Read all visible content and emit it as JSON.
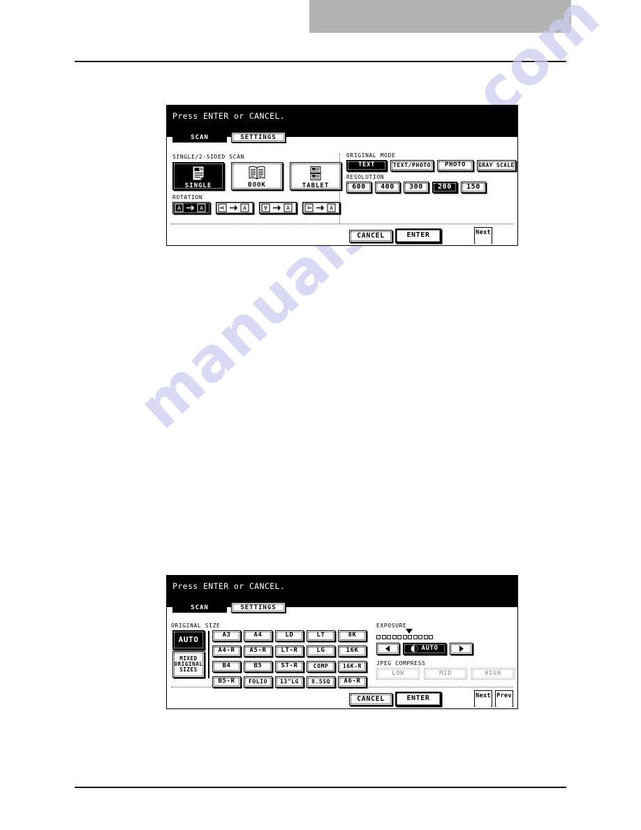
{
  "page": {
    "watermark_text": "manualshive.com",
    "header_block_color": "#b3b3b3"
  },
  "panel1": {
    "prompt": "Press ENTER or CANCEL.",
    "tabs": [
      {
        "label": "SCAN",
        "selected": true
      },
      {
        "label": "SETTINGS",
        "selected": false
      }
    ],
    "scan_mode": {
      "group_label": "SINGLE/2-SIDED SCAN",
      "options": [
        {
          "label": "SINGLE",
          "icon": "single-page-icon",
          "selected": true
        },
        {
          "label": "BOOK",
          "icon": "open-book-icon",
          "selected": false
        },
        {
          "label": "TABLET",
          "icon": "tablet-pages-icon",
          "selected": false
        }
      ]
    },
    "rotation": {
      "group_label": "ROTATION",
      "options": [
        {
          "name": "rotation-0",
          "from": "A",
          "to": "A",
          "selected": true
        },
        {
          "name": "rotation-90",
          "from": "A",
          "to": "A",
          "selected": false
        },
        {
          "name": "rotation-180",
          "from": "A",
          "to": "A",
          "selected": false
        },
        {
          "name": "rotation-270",
          "from": "A",
          "to": "A",
          "selected": false
        }
      ]
    },
    "original_mode": {
      "group_label": "ORIGINAL MODE",
      "options": [
        {
          "label": "TEXT",
          "selected": true
        },
        {
          "label": "TEXT/PHOTO",
          "selected": false
        },
        {
          "label": "PHOTO",
          "selected": false
        },
        {
          "label": "GRAY SCALE",
          "selected": false
        }
      ]
    },
    "resolution": {
      "group_label": "RESOLUTION",
      "options": [
        {
          "label": "600",
          "selected": false
        },
        {
          "label": "400",
          "selected": false
        },
        {
          "label": "300",
          "selected": false
        },
        {
          "label": "200",
          "selected": true
        },
        {
          "label": "150",
          "selected": false
        }
      ]
    },
    "footer": {
      "cancel_label": "CANCEL",
      "enter_label": "ENTER",
      "next_label": "Next"
    }
  },
  "panel2": {
    "prompt": "Press ENTER or CANCEL.",
    "tabs": [
      {
        "label": "SCAN",
        "selected": true
      },
      {
        "label": "SETTINGS",
        "selected": false
      }
    ],
    "original_size": {
      "group_label": "ORIGINAL SIZE",
      "auto_label": "AUTO",
      "auto_selected": true,
      "mixed_label_lines": [
        "MIXED",
        "ORIGINAL",
        "SIZES"
      ],
      "mixed_selected": false,
      "grid": [
        [
          "A3",
          "A4",
          "LD",
          "LT",
          "8K"
        ],
        [
          "A4-R",
          "A5-R",
          "LT-R",
          "LG",
          "16K"
        ],
        [
          "B4",
          "B5",
          "ST-R",
          "COMP",
          "16K-R"
        ],
        [
          "B5-R",
          "FOLIO",
          "13\"LG",
          "8.5SQ",
          "A6-R"
        ]
      ]
    },
    "exposure": {
      "group_label": "EXPOSURE",
      "tick_count": 11,
      "pointer_index": 5,
      "decrease_icon": "left-arrow-icon",
      "increase_icon": "right-arrow-icon",
      "auto_label": "AUTO",
      "auto_icon": "auto-exposure-icon",
      "auto_selected": true
    },
    "jpeg_compress": {
      "group_label": "JPEG COMPRESS",
      "options": [
        {
          "label": "LOW",
          "disabled": true
        },
        {
          "label": "MID",
          "disabled": true
        },
        {
          "label": "HIGH",
          "disabled": true
        }
      ]
    },
    "footer": {
      "cancel_label": "CANCEL",
      "enter_label": "ENTER",
      "next_label": "Next",
      "prev_label": "Prev"
    }
  }
}
